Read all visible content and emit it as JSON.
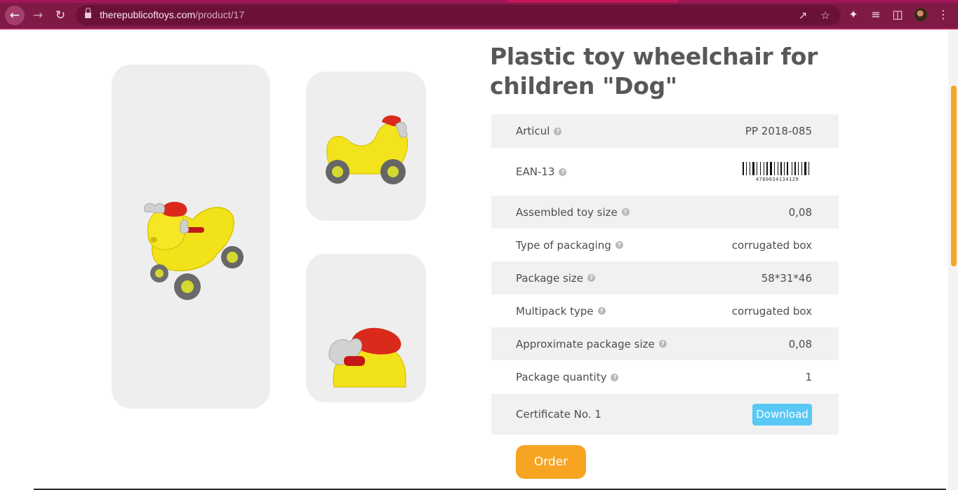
{
  "browser": {
    "url_domain": "therepublicoftoys.com",
    "url_path": "/product/17"
  },
  "product": {
    "title": "Plastic toy wheelchair for children \"Dog\"",
    "images": [
      "main-image",
      "side-image-1",
      "side-image-2"
    ]
  },
  "specs": [
    {
      "label": "Articul",
      "value": "PP 2018-085",
      "help": true,
      "shaded": true
    },
    {
      "label": "EAN-13",
      "value": "4780034134129",
      "help": true,
      "shaded": false,
      "type": "barcode"
    },
    {
      "label": "Assembled toy size",
      "value": "0,08",
      "help": true,
      "shaded": true
    },
    {
      "label": "Type of packaging",
      "value": "corrugated box",
      "help": true,
      "shaded": false
    },
    {
      "label": "Package size",
      "value": "58*31*46",
      "help": true,
      "shaded": true
    },
    {
      "label": "Multipack type",
      "value": "corrugated box",
      "help": true,
      "shaded": false
    },
    {
      "label": "Approximate package size",
      "value": "0,08",
      "help": true,
      "shaded": true
    },
    {
      "label": "Package quantity",
      "value": "1",
      "help": true,
      "shaded": false
    },
    {
      "label": "Certificate No. 1",
      "value": "Download",
      "help": false,
      "shaded": true,
      "type": "button"
    }
  ],
  "actions": {
    "order_label": "Order",
    "download_label": "Download"
  },
  "colors": {
    "chrome": "#7f1a47",
    "accent_orange": "#f7a422",
    "download_blue": "#5ac8f5",
    "card_grey": "#eeeeee"
  }
}
